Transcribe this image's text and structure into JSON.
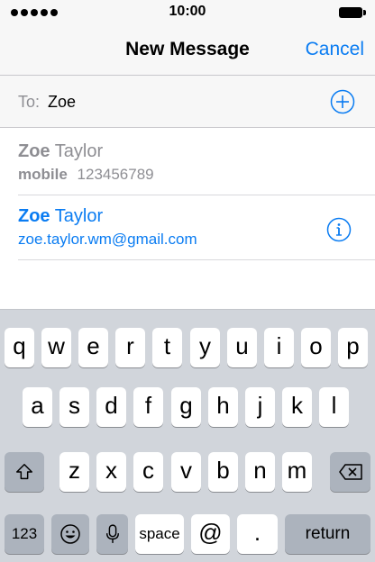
{
  "status_bar": {
    "time": "10:00"
  },
  "nav": {
    "title": "New Message",
    "cancel_label": "Cancel"
  },
  "recipient": {
    "to_label": "To:",
    "value": "Zoe"
  },
  "suggestions": [
    {
      "first_name": "Zoe",
      "last_name": "Taylor",
      "detail_label": "mobile",
      "detail_value": "123456789",
      "style": "gray"
    },
    {
      "first_name": "Zoe",
      "last_name": "Taylor",
      "detail_value": "zoe.taylor.wm@gmail.com",
      "style": "blue"
    }
  ],
  "keyboard": {
    "row1": [
      "q",
      "w",
      "e",
      "r",
      "t",
      "y",
      "u",
      "i",
      "o",
      "p"
    ],
    "row2": [
      "a",
      "s",
      "d",
      "f",
      "g",
      "h",
      "j",
      "k",
      "l"
    ],
    "row3": [
      "z",
      "x",
      "c",
      "v",
      "b",
      "n",
      "m"
    ],
    "numbers_label": "123",
    "space_label": "space",
    "at_label": "@",
    "period_label": ".",
    "return_label": "return"
  },
  "colors": {
    "accent": "#0a7cf2",
    "keyboard_bg": "#d1d5db",
    "secondary_text": "#8e8e93"
  }
}
